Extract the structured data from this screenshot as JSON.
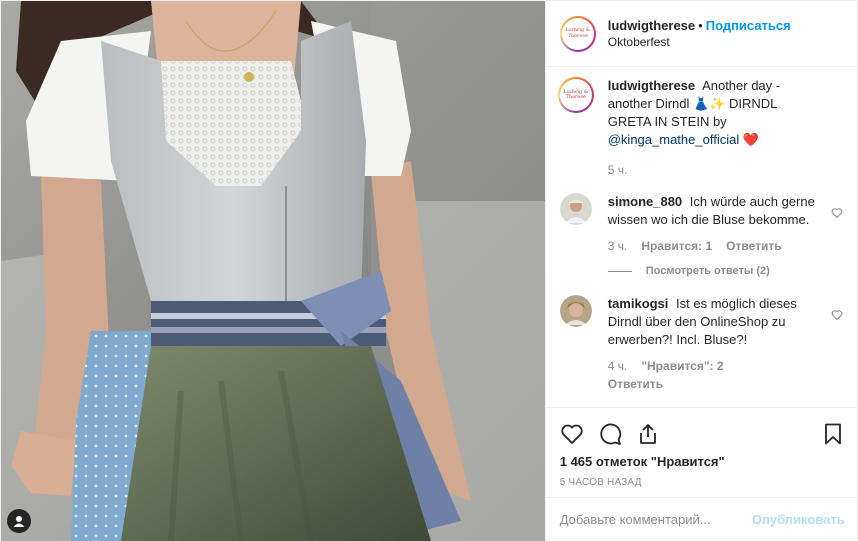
{
  "header": {
    "username": "ludwigtherese",
    "separator": "•",
    "follow_label": "Подписаться",
    "location": "Oktoberfest",
    "avatar_text": "Ludwig & Therese"
  },
  "caption": {
    "username": "ludwigtherese",
    "text": "Another day - another Dirndl 👗✨ DIRNDL GRETA IN STEIN by",
    "mention": "@kinga_mathe_official",
    "emoji_end": "❤️",
    "age": "5 ч."
  },
  "comments": [
    {
      "username": "simone_880",
      "text": "Ich würde auch gerne wissen wo ich die Bluse bekomme.",
      "age": "3 ч.",
      "likes": "Нравится: 1",
      "reply_label": "Ответить",
      "view_replies": "Посмотреть ответы (2)"
    },
    {
      "username": "tamikogsi",
      "text": "Ist es möglich dieses Dirndl über den OnlineShop zu erwerben?! Incl. Bluse?!",
      "age": "4 ч.",
      "likes": "\"Нравится\": 2",
      "reply_label": "Ответить"
    }
  ],
  "footer": {
    "likes": "1 465 отметок \"Нравится\"",
    "time": "5 ЧАСОВ НАЗАД",
    "comment_placeholder": "Добавьте комментарий...",
    "publish_label": "Опубликовать"
  },
  "icons": {
    "like": "heart-icon",
    "comment": "comment-icon",
    "share": "share-icon",
    "save": "bookmark-icon",
    "tag": "user-tag-icon"
  },
  "colors": {
    "accent": "#0095f6",
    "mention": "#00376b",
    "muted": "#8e8e8e",
    "publish_disabled": "#b2dffc"
  }
}
